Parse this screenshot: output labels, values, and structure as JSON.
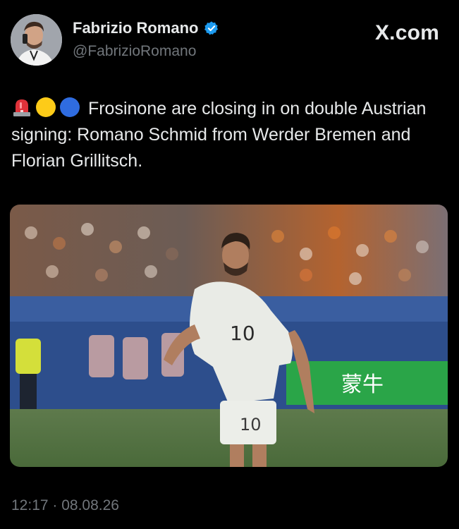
{
  "author": {
    "name": "Fabrizio Romano",
    "handle": "@FabrizioRomano",
    "verified": true,
    "avatar_icon": "avatar-photo"
  },
  "brand": {
    "label": "X.com"
  },
  "tweet": {
    "emojis": [
      "rotating-light-icon",
      "yellow-circle-icon",
      "blue-circle-icon"
    ],
    "text": "Frosinone are closing in on double Austrian signing: Romano Schmid from Werder Bremen and Florian Grillitsch."
  },
  "media": {
    "type": "photo",
    "jersey_number": "10",
    "sponsor_text": "蒙牛"
  },
  "meta": {
    "timestamp": "12:17 · 08.08.26"
  },
  "colors": {
    "background": "#000000",
    "text": "#e7e9ea",
    "muted": "#71767b",
    "verified": "#1d9bf0"
  }
}
